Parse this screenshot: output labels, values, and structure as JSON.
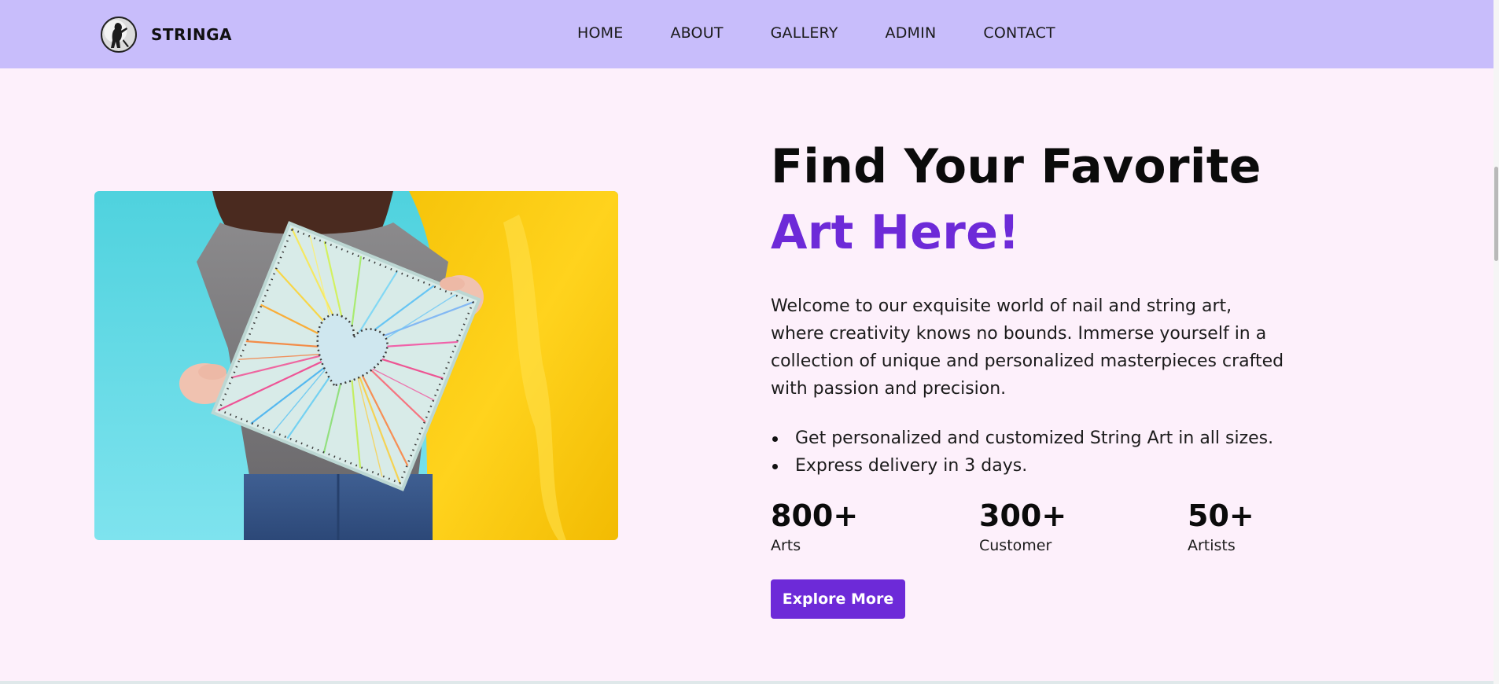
{
  "navbar": {
    "brand": "STRINGA",
    "links": [
      "HOME",
      "ABOUT",
      "GALLERY",
      "ADMIN",
      "CONTACT"
    ]
  },
  "hero": {
    "title_line1": "Find Your Favorite",
    "title_line2": "Art Here!",
    "intro": "Welcome to our exquisite world of nail and string art, where creativity knows no bounds. Immerse yourself in a collection of unique and personalized masterpieces crafted with passion and precision.",
    "features": [
      "Get personalized and customized String Art in all sizes.",
      "Express delivery in 3 days."
    ],
    "stats": [
      {
        "value": "800+",
        "label": "Arts"
      },
      {
        "value": "300+",
        "label": "Customer"
      },
      {
        "value": "50+",
        "label": "Artists"
      }
    ],
    "cta_label": "Explore More"
  },
  "colors": {
    "nav_bg": "#c8bdfb",
    "page_bg": "#fdf0fb",
    "accent": "#6d2ad8"
  },
  "icons": {
    "logo": "artist-silhouette-logo-icon"
  }
}
